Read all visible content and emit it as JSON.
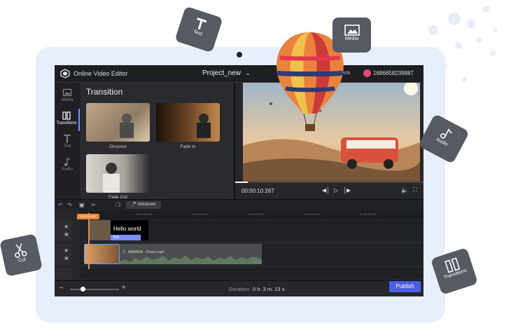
{
  "app": {
    "title": "Online Video Editor",
    "project_name": "Project_new",
    "objects_label": "jects",
    "user_id": "1686658239887"
  },
  "sidebar": {
    "items": [
      {
        "label": "Media",
        "icon": "image-icon"
      },
      {
        "label": "Transitions",
        "icon": "transitions-icon"
      },
      {
        "label": "Text",
        "icon": "text-icon"
      },
      {
        "label": "Audio",
        "icon": "music-note-icon"
      }
    ]
  },
  "panel": {
    "title": "Transition",
    "items": [
      {
        "label": "Dissolve"
      },
      {
        "label": "Fade In"
      },
      {
        "label": "Fade Out"
      }
    ]
  },
  "player": {
    "time": "00:00:10.267"
  },
  "timeline": {
    "voiceover_label": "Voiceover",
    "playhead_time": "00:00:10.267",
    "ruler_marks": [
      "00:01:00.000",
      "00:02:00.000",
      "00:03:00.000",
      "00:04:00.000",
      "00:05:00.000"
    ],
    "text_clip": {
      "text": "Hello world",
      "badge": "Text"
    },
    "audio_clip": {
      "name": "AMANDA - Chaos.mp3"
    }
  },
  "footer": {
    "duration_label": "Duration:",
    "duration_value": "0 h. 3 m. 13 s.",
    "publish_label": "Publish"
  },
  "floating_tiles": {
    "text": "Text",
    "media": "Media",
    "audio": "Audio",
    "cut": "Cut",
    "transitions": "Transitions"
  },
  "colors": {
    "accent": "#4a5ee8",
    "playhead": "#f08a3c",
    "tile": "#565a63",
    "tablet": "#e8effc"
  }
}
